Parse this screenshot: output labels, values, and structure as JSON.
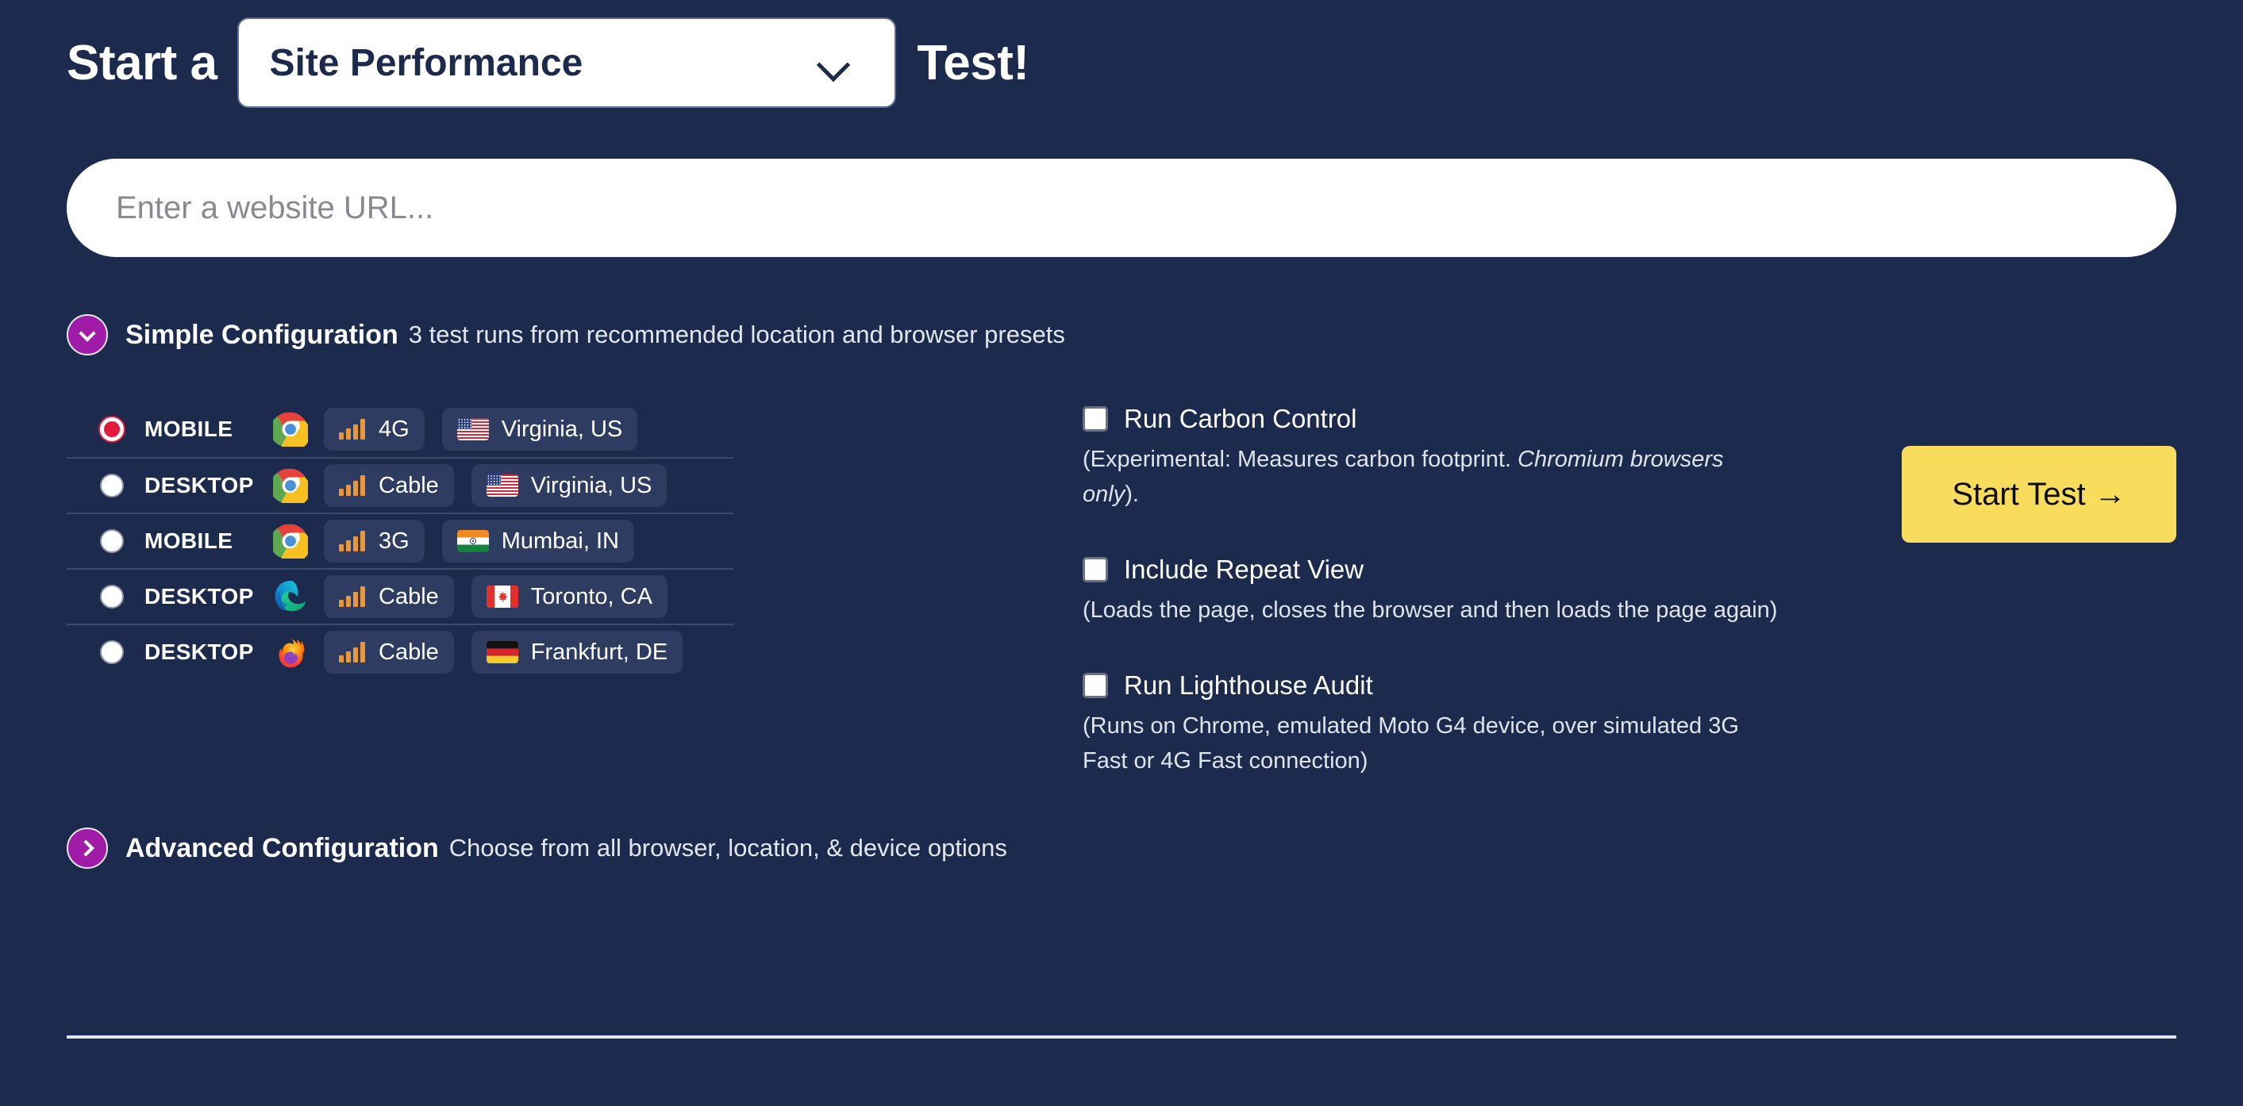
{
  "header": {
    "title_prefix": "Start a",
    "title_suffix": "Test!",
    "test_type_selected": "Site Performance",
    "chevron_icon": "chevron-down-icon"
  },
  "url_field": {
    "placeholder": "Enter a website URL...",
    "value": ""
  },
  "simple_config": {
    "title": "Simple Configuration",
    "subtitle": "3 test runs from recommended location and browser presets",
    "disclosure_icon": "chevron-down-circle-icon",
    "accent_color": "#a01ca8",
    "presets": [
      {
        "device": "MOBILE",
        "browser_icon": "chrome-icon",
        "connection": "4G",
        "connection_icon": "signal-bars-icon",
        "location": "Virginia, US",
        "flag_icon": "flag-us-icon",
        "selected": true
      },
      {
        "device": "DESKTOP",
        "browser_icon": "chrome-icon",
        "connection": "Cable",
        "connection_icon": "signal-bars-icon",
        "location": "Virginia, US",
        "flag_icon": "flag-us-icon",
        "selected": false
      },
      {
        "device": "MOBILE",
        "browser_icon": "chrome-icon",
        "connection": "3G",
        "connection_icon": "signal-bars-icon",
        "location": "Mumbai, IN",
        "flag_icon": "flag-in-icon",
        "selected": false
      },
      {
        "device": "DESKTOP",
        "browser_icon": "edge-icon",
        "connection": "Cable",
        "connection_icon": "signal-bars-icon",
        "location": "Toronto, CA",
        "flag_icon": "flag-ca-icon",
        "selected": false
      },
      {
        "device": "DESKTOP",
        "browser_icon": "firefox-icon",
        "connection": "Cable",
        "connection_icon": "signal-bars-icon",
        "location": "Frankfurt, DE",
        "flag_icon": "flag-de-icon",
        "selected": false
      }
    ]
  },
  "options": [
    {
      "label": "Run Carbon Control",
      "checked": false,
      "desc_prefix": "(Experimental: Measures carbon footprint. ",
      "desc_italic": "Chromium browsers only",
      "desc_suffix": ")."
    },
    {
      "label": "Include Repeat View",
      "checked": false,
      "desc_prefix": "(Loads the page, closes the browser and then loads the page again)",
      "desc_italic": "",
      "desc_suffix": ""
    },
    {
      "label": "Run Lighthouse Audit",
      "checked": false,
      "desc_prefix": "(Runs on Chrome, emulated Moto G4 device, over simulated 3G Fast or 4G Fast connection)",
      "desc_italic": "",
      "desc_suffix": ""
    }
  ],
  "start_button": {
    "label": "Start Test →",
    "color": "#f8dc5c"
  },
  "advanced_config": {
    "title": "Advanced Configuration",
    "subtitle": "Choose from all browser, location, & device options",
    "disclosure_icon": "chevron-right-circle-icon"
  },
  "theme": {
    "background": "#1c2b4d",
    "chip_background": "#2e3c61",
    "divider": "#3d4a6b",
    "selected_radio": "#e21b3c"
  }
}
